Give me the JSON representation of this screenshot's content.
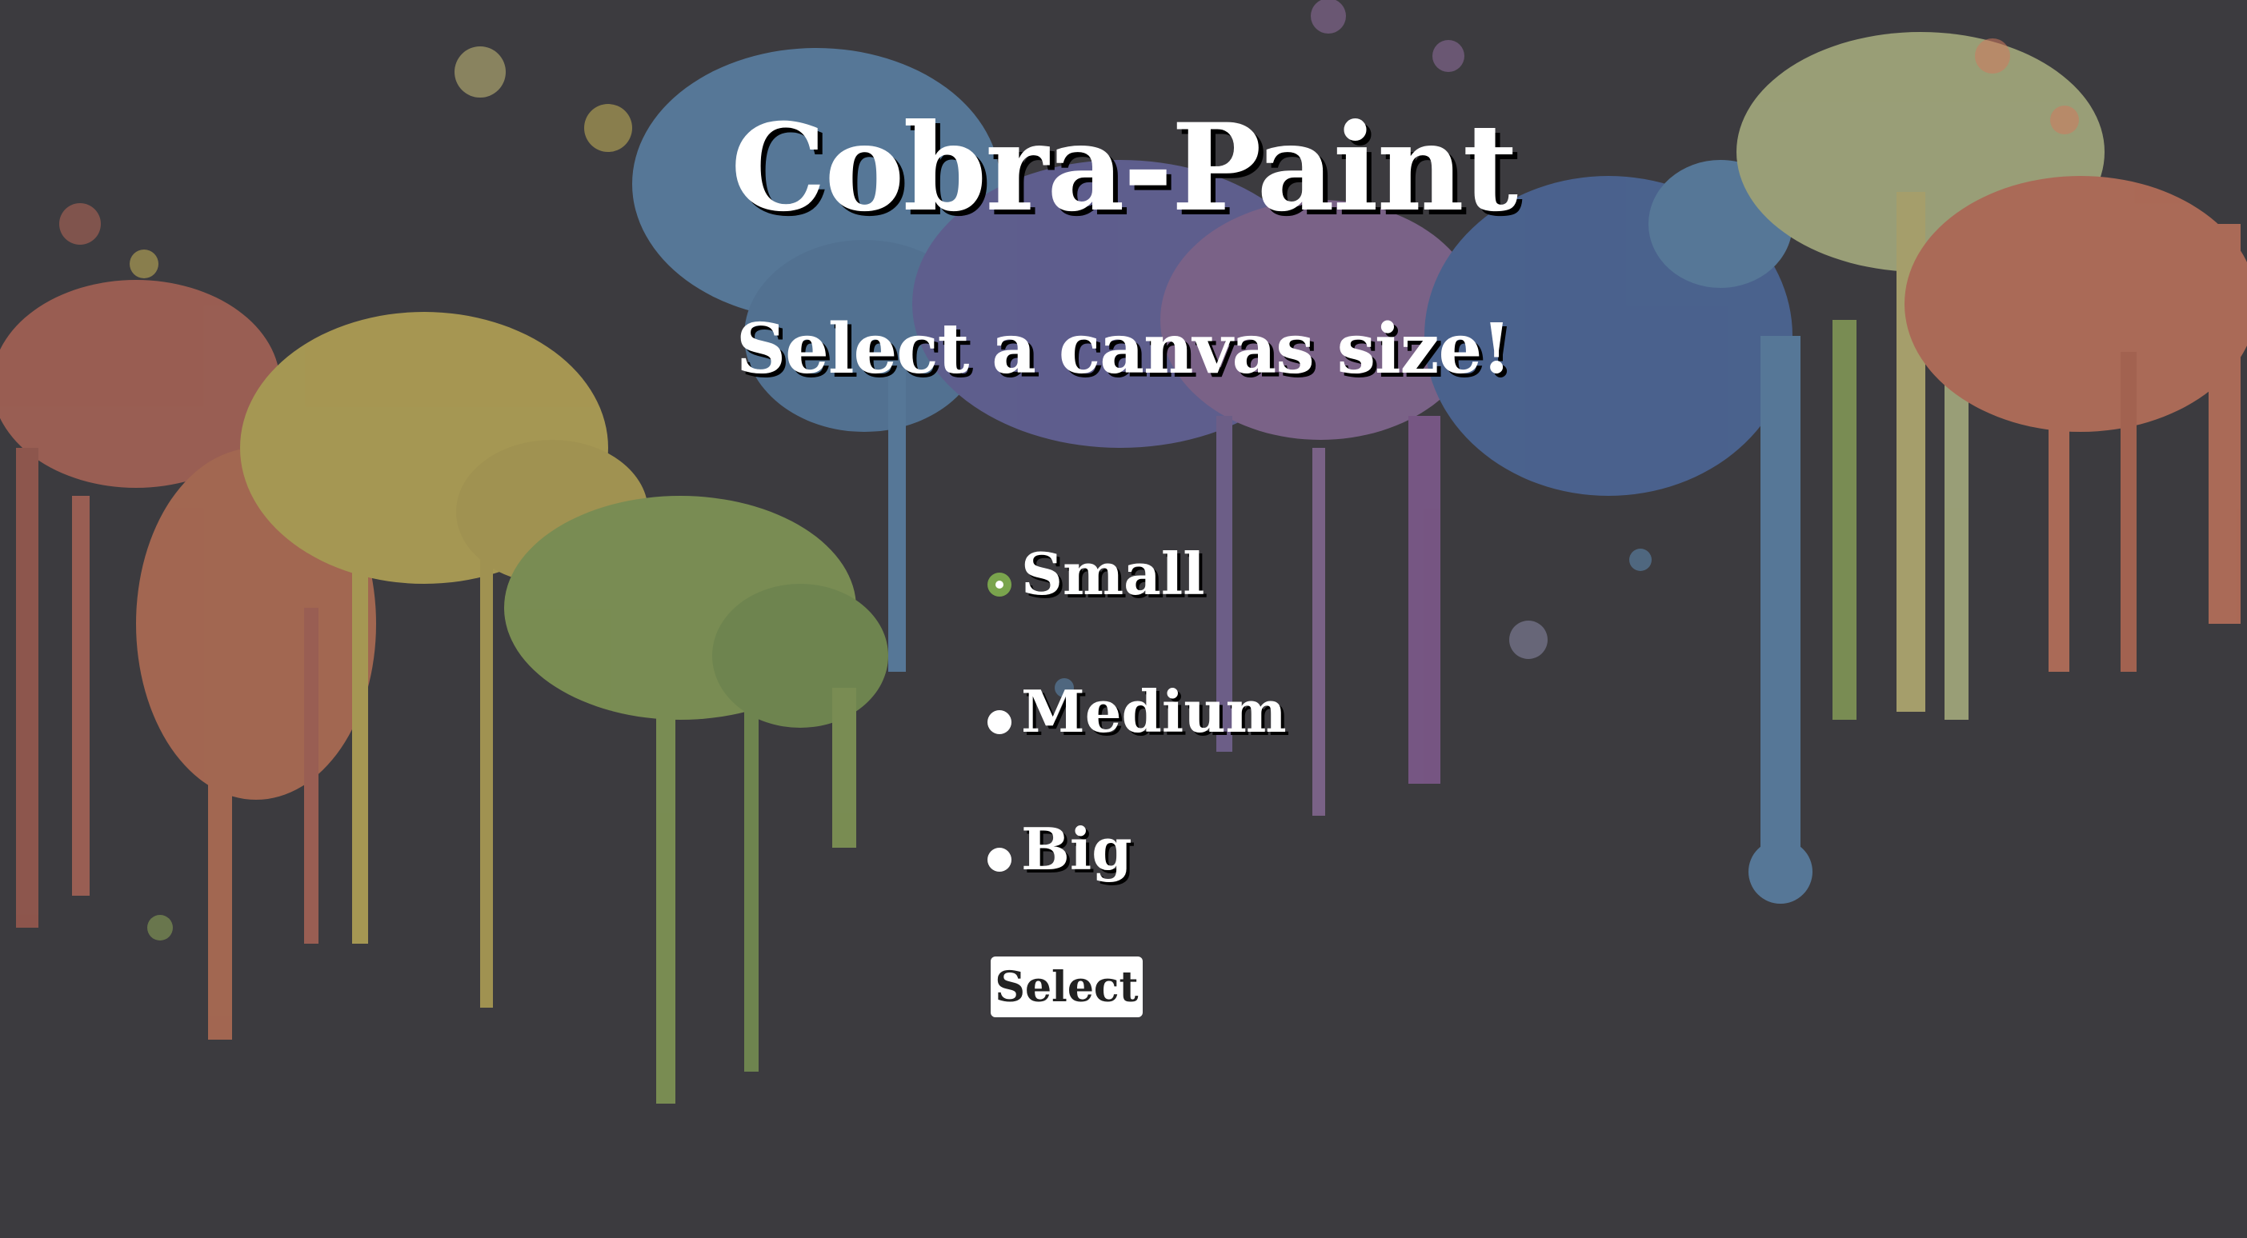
{
  "page": {
    "title": "Cobra-Paint",
    "subtitle": "Select a canvas size!"
  },
  "size_options": [
    {
      "label": "Small",
      "checked": true
    },
    {
      "label": "Medium",
      "checked": false
    },
    {
      "label": "Big",
      "checked": false
    }
  ],
  "select_button": {
    "label": "Select"
  },
  "colors": {
    "background": "#3c3b3f",
    "text": "#ffffff",
    "radio_checked": "#7aa44d",
    "paint_splatter": [
      "#b86a5a",
      "#c9b65a",
      "#8ea85a",
      "#5f8cb5",
      "#6a6aa8",
      "#8f6f9f",
      "#b8c08a",
      "#cf7a5f"
    ]
  }
}
